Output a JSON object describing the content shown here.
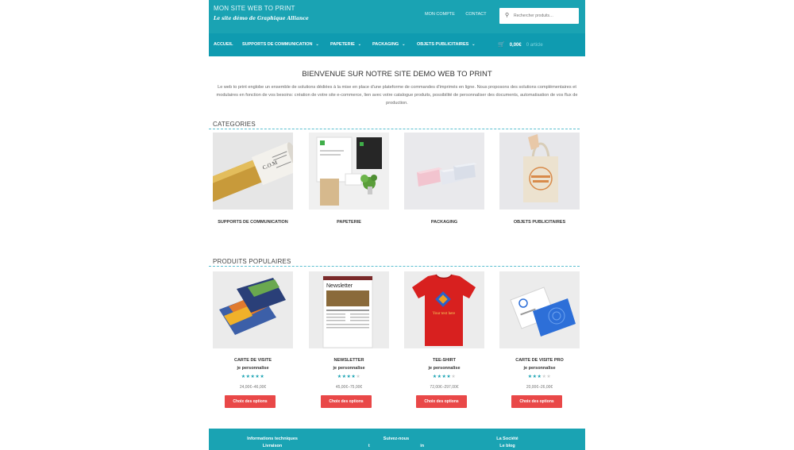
{
  "header": {
    "site_title": "MON SITE WEB TO PRINT",
    "tagline": "Le site démo de Graphique Alliance",
    "links": [
      "MON COMPTE",
      "CONTACT"
    ],
    "search_placeholder": "Rechercher produits…"
  },
  "nav": {
    "items": [
      "ACCUEIL",
      "SUPPORTS DE COMMUNICATION",
      "PAPETERIE",
      "PACKAGING",
      "OBJETS PUBLICITAIRES"
    ],
    "chevron": "⌄",
    "cart_total": "0,00€",
    "cart_muted": "0 article"
  },
  "main": {
    "welcome_title": "BIENVENUE SUR NOTRE SITE DEMO WEB TO PRINT",
    "intro": "Le web to print englobe un ensemble de solutions dédiées à la mise en place d'une plateforme de commandes d'imprimés en ligne. Nous proposons des solutions complémentaires et modulaires en fonction de vos besoins: création de votre site e-commerce, lien avec votre catalogue produits, possibilité de personnaliser des documents, automatisation de vos flux de production."
  },
  "categories": {
    "title": "CATEGORIES",
    "items": [
      {
        "label": "SUPPORTS DE COMMUNICATION"
      },
      {
        "label": "PAPETERIE"
      },
      {
        "label": "PACKAGING"
      },
      {
        "label": "OBJETS PUBLICITAIRES"
      }
    ]
  },
  "products": {
    "title": "PRODUITS POPULAIRES",
    "button_label": "Choix des options",
    "items": [
      {
        "name": "CARTE DE VISITE",
        "subtitle": "je personnalise",
        "rating": 5,
        "price": "24,00€–46,00€"
      },
      {
        "name": "NEWSLETTER",
        "subtitle": "je personnalise",
        "rating": 4,
        "price": "45,00€–75,00€"
      },
      {
        "name": "TEE-SHIRT",
        "subtitle": "je personnalise",
        "rating": 4,
        "price": "72,00€–297,00€"
      },
      {
        "name": "CARTE DE VISITE PRO",
        "subtitle": "je personnalise",
        "rating": 3,
        "price": "20,00€–26,00€"
      }
    ],
    "image_texts": {
      "newsletter_heading": "Newsletter",
      "tshirt_text": "Your text here"
    }
  },
  "footer": {
    "col1": [
      "Informations techniques",
      "Livraison"
    ],
    "col2_title": "Suivez-nous",
    "col3": [
      "La Société",
      "Le blog"
    ],
    "social": [
      "t",
      "in"
    ]
  },
  "colors": {
    "brand": "#1aa3b3",
    "nav": "#0f9bb0",
    "button": "#e94848",
    "star_on": "#1aa3b3",
    "star_off": "#cfcfcf"
  }
}
